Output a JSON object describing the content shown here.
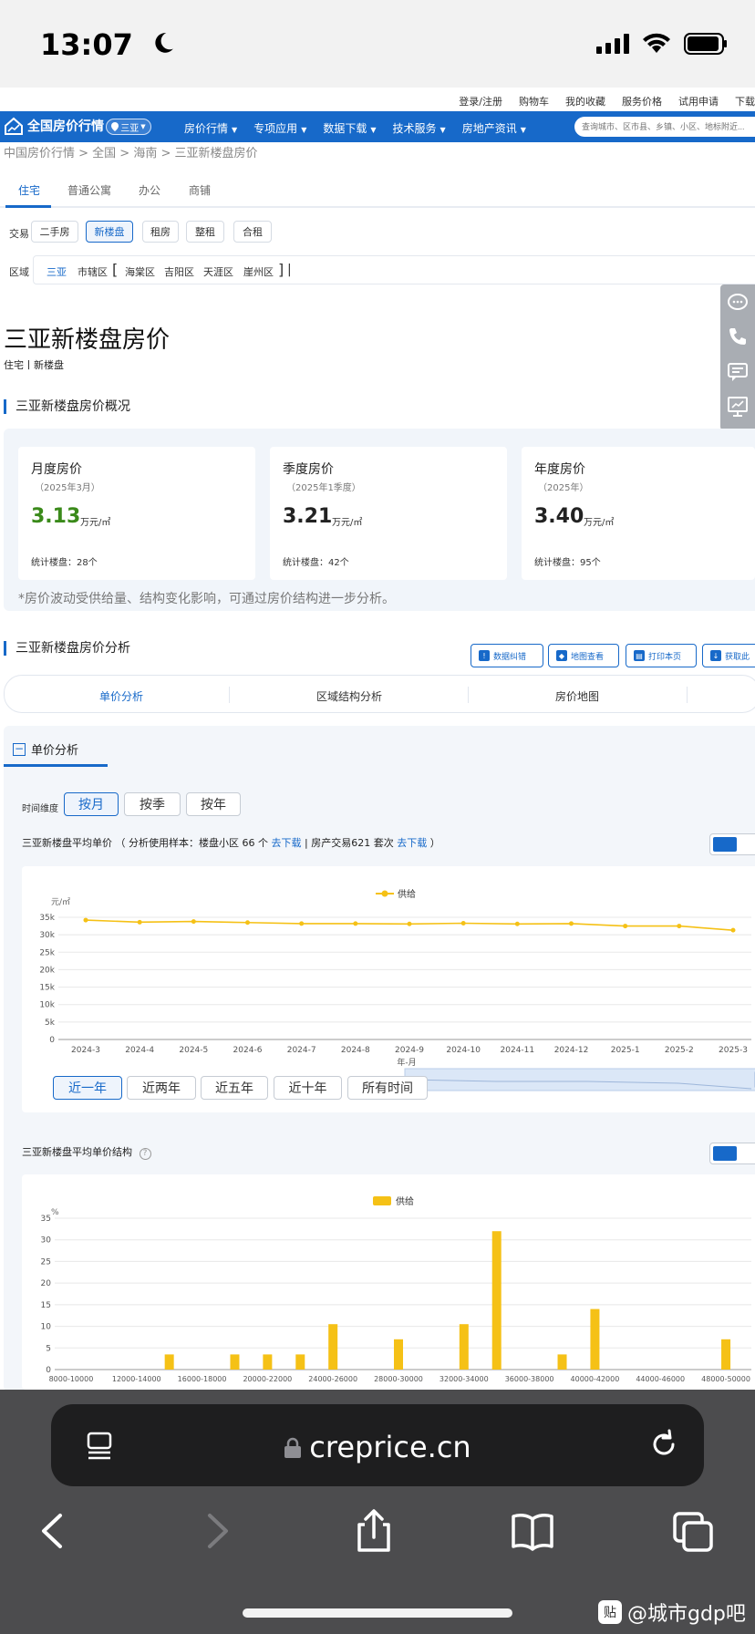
{
  "status_bar": {
    "time": "13:07"
  },
  "util_bar": {
    "items": [
      "登录/注册",
      "购物车",
      "我的收藏",
      "服务价格",
      "试用申请",
      "下载"
    ]
  },
  "nav": {
    "logo_text": "全国房价行情",
    "city": "三亚",
    "menu": [
      "房价行情",
      "专项应用",
      "数据下载",
      "技术服务",
      "房地产资讯"
    ],
    "search_placeholder": "查询城市、区市县、乡镇、小区、地标附近..."
  },
  "breadcrumb": "中国房价行情 > 全国 > 海南 > 三亚新楼盘房价",
  "property_tabs": [
    "住宅",
    "普通公寓",
    "办公",
    "商铺"
  ],
  "filters": {
    "trade_label": "交易",
    "trade_options": [
      "二手房",
      "新楼盘",
      "租房",
      "整租",
      "合租"
    ],
    "region_label": "区域",
    "region_items": [
      "三亚",
      "市辖区",
      "[",
      "海棠区",
      "吉阳区",
      "天涯区",
      "崖州区",
      "]",
      "|"
    ]
  },
  "page": {
    "title": "三亚新楼盘房价",
    "subtitle": "住宅丨新楼盘"
  },
  "overview": {
    "heading": "三亚新楼盘房价概况",
    "cards": [
      {
        "title": "月度房价",
        "period": "（2025年3月）",
        "value": "3.13",
        "unit": "万元/㎡",
        "count": "统计楼盘：28个"
      },
      {
        "title": "季度房价",
        "period": "（2025年1季度）",
        "value": "3.21",
        "unit": "万元/㎡",
        "count": "统计楼盘：42个"
      },
      {
        "title": "年度房价",
        "period": "（2025年）",
        "value": "3.40",
        "unit": "万元/㎡",
        "count": "统计楼盘：95个"
      }
    ],
    "note": "*房价波动受供给量、结构变化影响，可通过房价结构进一步分析。"
  },
  "analysis": {
    "heading": "三亚新楼盘房价分析",
    "actions": [
      "数据纠错",
      "地图查看",
      "打印本页",
      "获取此"
    ],
    "subtabs": [
      "单价分析",
      "区域结构分析",
      "房价地图"
    ],
    "unit_section": "单价分析",
    "time_label": "时间维度",
    "time_options": [
      "按月",
      "按季",
      "按年"
    ],
    "chart1_title": "三亚新楼盘平均单价",
    "chart1_sample_prefix": "（ 分析使用样本：楼盘小区 66 个",
    "chart1_link1": "去下载",
    "chart1_sample_mid": "| 房产交易621 套次",
    "chart1_link2": "去下载",
    "chart1_sample_suffix": "）",
    "range_options": [
      "近一年",
      "近两年",
      "近五年",
      "近十年",
      "所有时间"
    ],
    "chart2_title": "三亚新楼盘平均单价结构"
  },
  "chart_data": [
    {
      "type": "line",
      "legend": [
        "供给"
      ],
      "ylabel": "元/㎡",
      "xlabel": "年-月",
      "x": [
        "2024-3",
        "2024-4",
        "2024-5",
        "2024-6",
        "2024-7",
        "2024-8",
        "2024-9",
        "2024-10",
        "2024-11",
        "2024-12",
        "2025-1",
        "2025-2",
        "2025-3"
      ],
      "series": [
        {
          "name": "供给",
          "values": [
            34200,
            33600,
            33800,
            33500,
            33200,
            33200,
            33100,
            33300,
            33100,
            33200,
            32500,
            32500,
            31300
          ]
        }
      ],
      "yticks": [
        "0",
        "5k",
        "10k",
        "15k",
        "20k",
        "25k",
        "30k",
        "35k"
      ],
      "ylim": [
        0,
        35000
      ],
      "grid": true,
      "legend_position": "top",
      "color": "#f5c116"
    },
    {
      "type": "bar",
      "legend": [
        "供给"
      ],
      "ylabel": "%",
      "categories": [
        "8000-10000",
        "10000-12000",
        "12000-14000",
        "14000-16000",
        "16000-18000",
        "18000-20000",
        "20000-22000",
        "22000-24000",
        "24000-26000",
        "26000-28000",
        "28000-30000",
        "30000-32000",
        "32000-34000",
        "34000-36000",
        "36000-38000",
        "38000-40000",
        "40000-42000",
        "42000-44000",
        "44000-46000",
        "46000-48000",
        "48000-50000"
      ],
      "xtick_labels": [
        "8000-10000",
        "12000-14000",
        "16000-18000",
        "20000-22000",
        "24000-26000",
        "28000-30000",
        "32000-34000",
        "36000-38000",
        "40000-42000",
        "44000-46000",
        "48000-50000"
      ],
      "series": [
        {
          "name": "供给",
          "values": [
            0,
            0,
            0,
            3.5,
            0,
            3.5,
            3.5,
            3.5,
            10.5,
            0,
            7,
            0,
            10.5,
            32,
            0,
            3.5,
            14,
            0,
            0,
            0,
            7
          ]
        }
      ],
      "yticks": [
        "0",
        "5",
        "10",
        "15",
        "20",
        "25",
        "30",
        "35"
      ],
      "ylim": [
        0,
        35
      ],
      "grid": true,
      "legend_position": "top",
      "color": "#f5c116"
    }
  ],
  "safari": {
    "url": "creprice.cn"
  },
  "watermark": {
    "badge": "贴",
    "text": "@城市gdp吧"
  }
}
